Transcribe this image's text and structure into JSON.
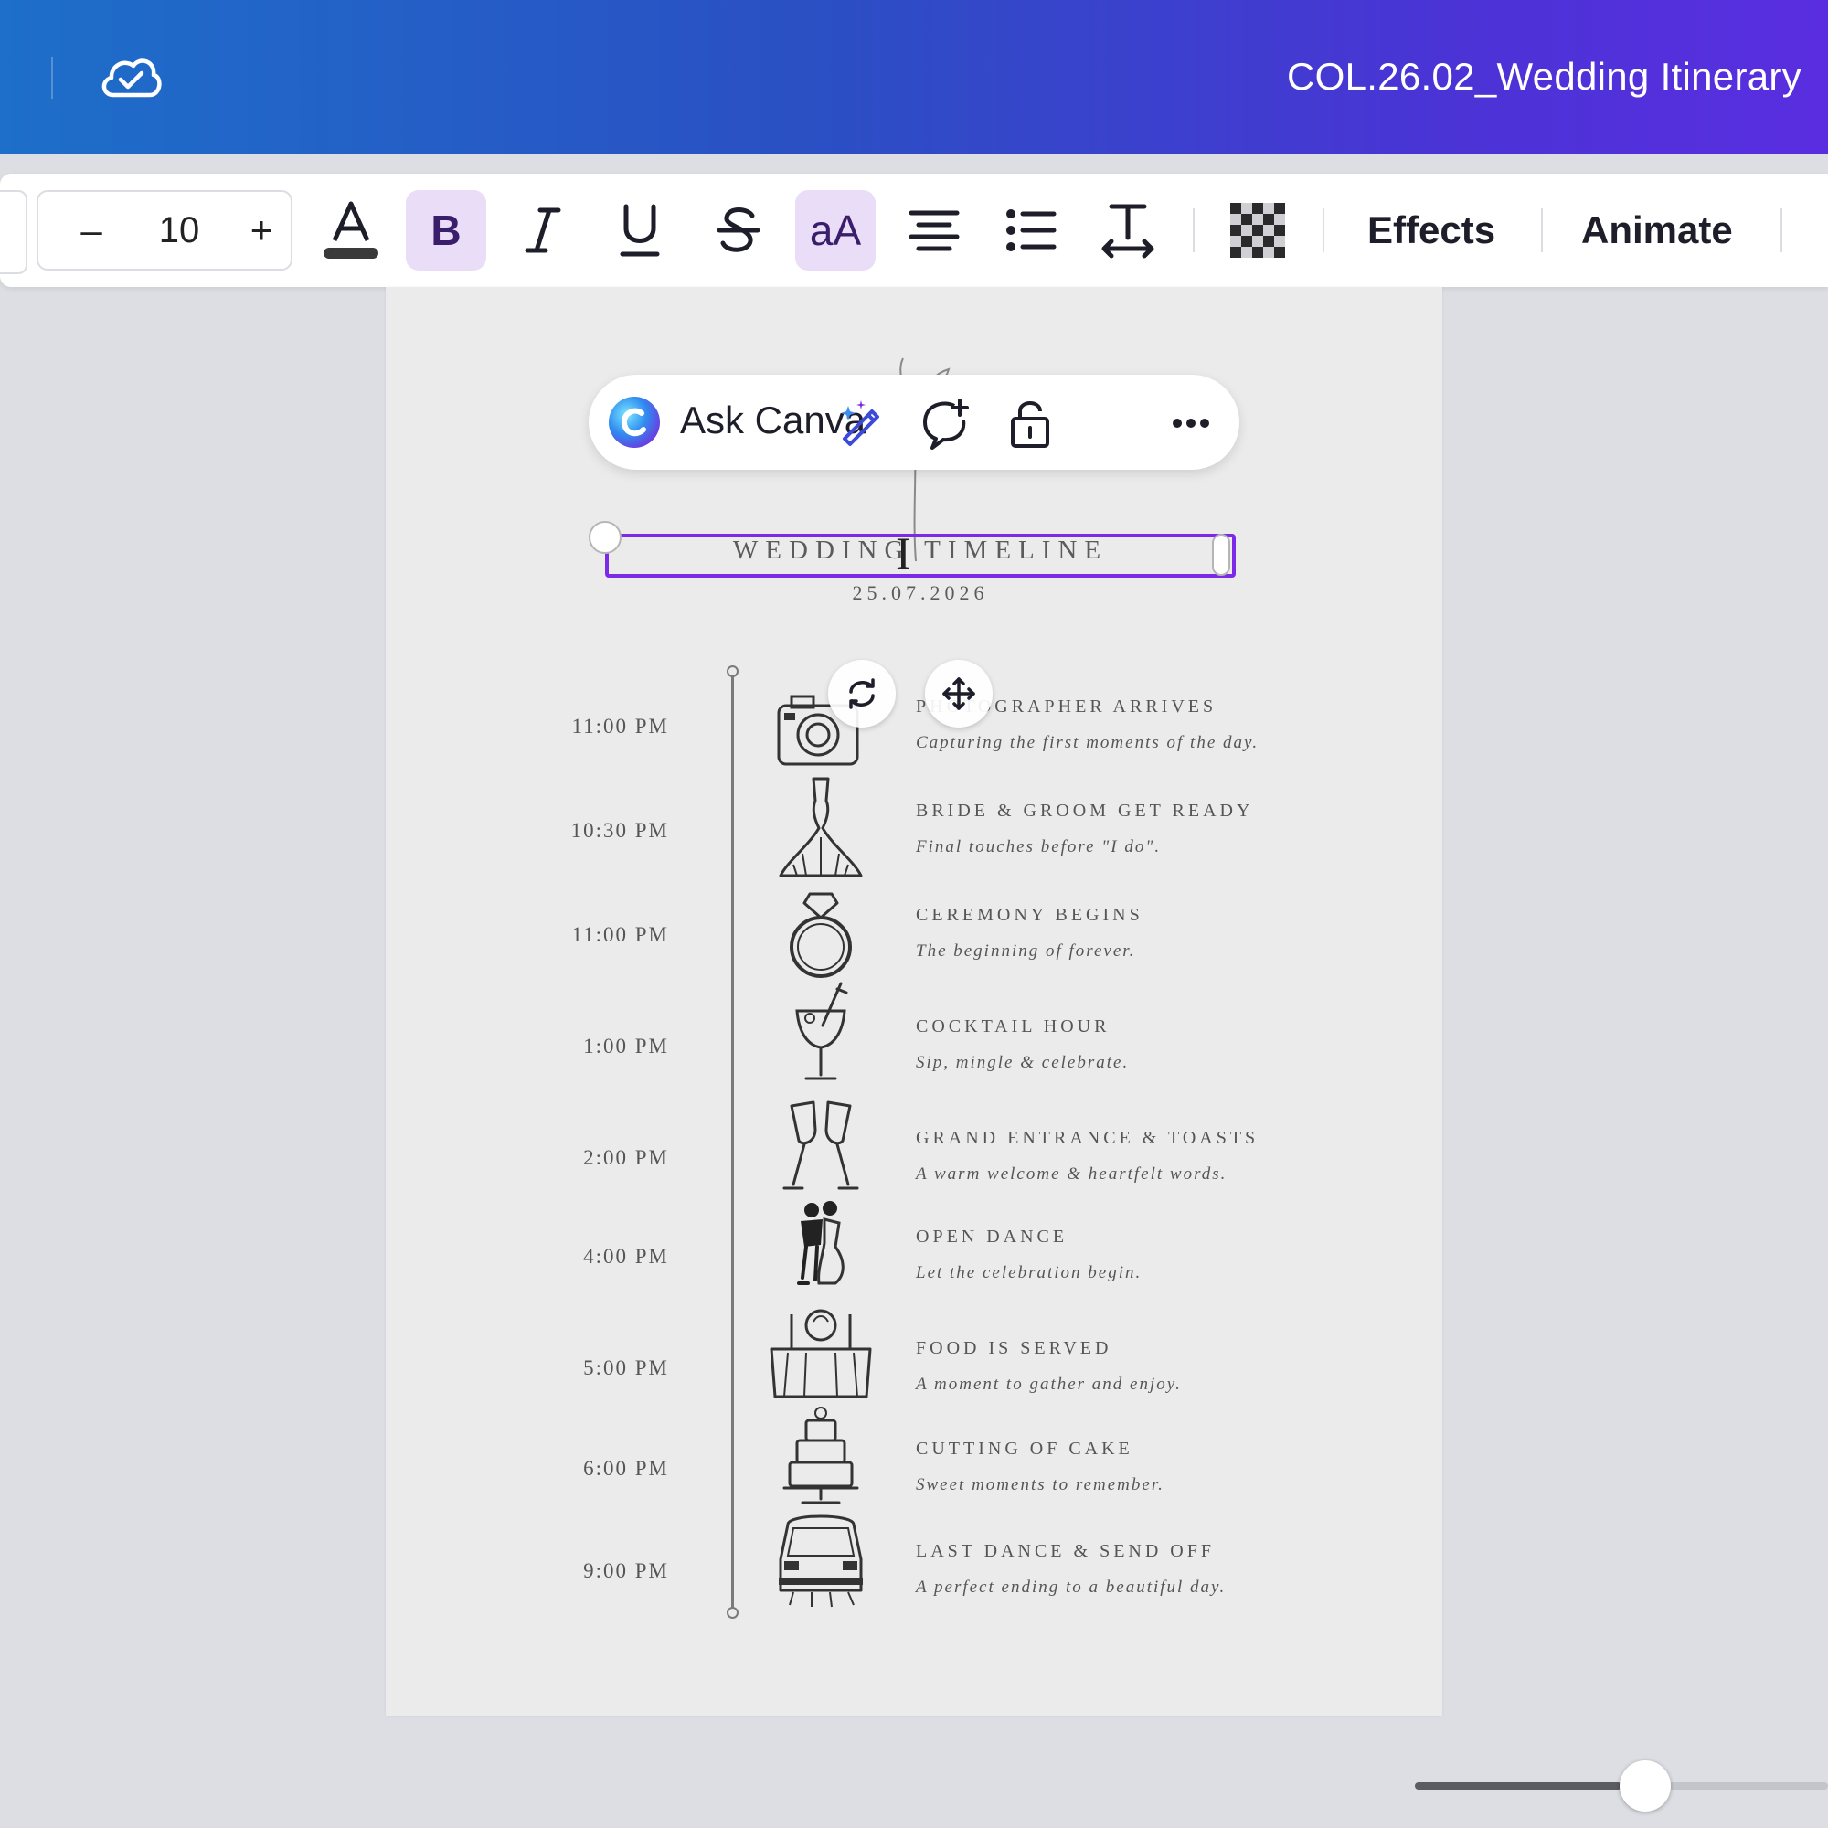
{
  "header": {
    "document_title": "COL.26.02_Wedding Itinerary",
    "icons": [
      "cloud-saved-icon"
    ]
  },
  "toolbar": {
    "font_size": "10",
    "decrease_label": "–",
    "increase_label": "+",
    "effects_label": "Effects",
    "animate_label": "Animate",
    "case_label": "aA",
    "bold_label": "B",
    "bold_active": true,
    "case_active": true,
    "icons": [
      "text-color-icon",
      "bold-icon",
      "italic-icon",
      "underline-icon",
      "strikethrough-icon",
      "letter-case-icon",
      "align-center-icon",
      "list-icon",
      "spacing-icon",
      "transparency-icon"
    ]
  },
  "ask_canva": {
    "label": "Ask Canva",
    "icons": [
      "canva-assistant-logo-icon",
      "magic-write-icon",
      "add-comment-icon",
      "lock-icon",
      "more-icon"
    ]
  },
  "document": {
    "heading": "WEDDING TIMELINE",
    "date": "25.07.2026",
    "events": [
      {
        "time": "11:00 PM",
        "title": "PHOTOGRAPHER ARRIVES",
        "description": "Capturing the first moments of the day.",
        "icon": "camera-icon"
      },
      {
        "time": "10:30 PM",
        "title": "BRIDE & GROOM GET READY",
        "description": "Final touches before \"I do\".",
        "icon": "wedding-dress-icon"
      },
      {
        "time": "11:00 PM",
        "title": "CEREMONY BEGINS",
        "description": "The beginning of forever.",
        "icon": "ring-icon"
      },
      {
        "time": "1:00 PM",
        "title": "COCKTAIL HOUR",
        "description": "Sip, mingle & celebrate.",
        "icon": "cocktail-icon"
      },
      {
        "time": "2:00 PM",
        "title": "GRAND ENTRANCE & TOASTS",
        "description": "A warm welcome & heartfelt words.",
        "icon": "champagne-toast-icon"
      },
      {
        "time": "4:00 PM",
        "title": "OPEN DANCE",
        "description": "Let the celebration begin.",
        "icon": "dancing-couple-icon"
      },
      {
        "time": "5:00 PM",
        "title": "FOOD IS SERVED",
        "description": "A moment to gather and enjoy.",
        "icon": "dining-table-icon"
      },
      {
        "time": "6:00 PM",
        "title": "CUTTING OF CAKE",
        "description": "Sweet moments to remember.",
        "icon": "wedding-cake-icon"
      },
      {
        "time": "9:00 PM",
        "title": "LAST DANCE & SEND OFF",
        "description": "A perfect ending to a beautiful day.",
        "icon": "getaway-car-icon"
      }
    ]
  },
  "element_controls": {
    "icons": [
      "rotate-icon",
      "move-icon"
    ]
  },
  "zoom": {
    "level_fraction": 0.5
  },
  "colors": {
    "header_gradient_start": "#1d6fc9",
    "header_gradient_end": "#5a2ee0",
    "selection": "#7d2ae8",
    "active_tool_bg": "#e9ddf7",
    "page_bg": "#ebebeb",
    "canvas_bg": "#dcdee3"
  }
}
